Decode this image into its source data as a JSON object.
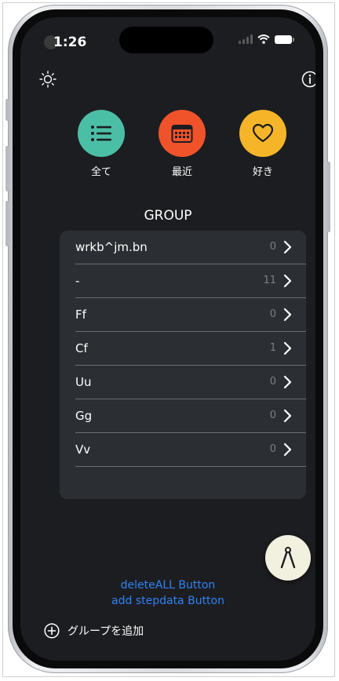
{
  "status_bar": {
    "time": "1:26"
  },
  "header": {
    "settings_icon": "sun-gear-icon",
    "info_icon": "info-icon"
  },
  "quick_access": [
    {
      "label": "全て",
      "icon": "list-icon",
      "color": "#4bbfa5"
    },
    {
      "label": "最近",
      "icon": "calendar-icon",
      "color": "#f0532a"
    },
    {
      "label": "好き",
      "icon": "heart-icon",
      "color": "#f6b529"
    }
  ],
  "group": {
    "title": "GROUP",
    "items": [
      {
        "name": "wrkb^jm.bn",
        "count": "0"
      },
      {
        "name": "-",
        "count": "11"
      },
      {
        "name": "Ff",
        "count": "0"
      },
      {
        "name": "Cf",
        "count": "1"
      },
      {
        "name": "Uu",
        "count": "0"
      },
      {
        "name": "Gg",
        "count": "0"
      },
      {
        "name": "Vv",
        "count": "0"
      }
    ]
  },
  "fab": {
    "icon": "compass-icon"
  },
  "buttons": {
    "delete_all": "deleteALL Button",
    "add_stepdata": "add stepdata Button",
    "add_group": "グループを追加"
  },
  "colors": {
    "background": "#1c1d20",
    "list_bg": "#2b2f33",
    "link": "#2f83f5",
    "fab_bg": "#f2f0de"
  }
}
